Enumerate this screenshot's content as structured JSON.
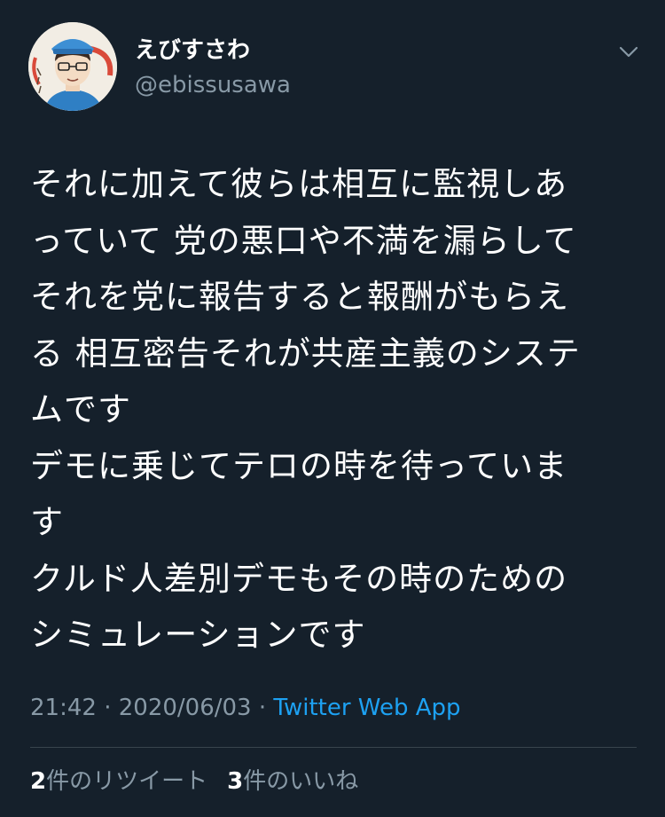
{
  "author": {
    "display_name": "えびすさわ",
    "handle": "@ebissusawa"
  },
  "tweet": {
    "lines": [
      "それに加えて彼らは相互に監視しあ",
      "っていて 党の悪口や不満を漏らして",
      "それを党に報告すると報酬がもらえ",
      "る 相互密告それが共産主義のシステ",
      "ムです",
      "デモに乗じてテロの時を待っていま",
      "す",
      "クルド人差別デモもその時のための",
      "シミュレーションです"
    ],
    "time": "21:42",
    "date": "2020/06/03",
    "separator": "·",
    "source": "Twitter Web App"
  },
  "stats": {
    "retweet_count": "2",
    "retweet_label": "件のリツイート",
    "like_count": "3",
    "like_label": "件のいいね"
  },
  "icons": {
    "menu": "chevron-down-icon"
  },
  "colors": {
    "background": "#15202b",
    "text": "#ffffff",
    "secondary": "#8899a6",
    "link": "#1da1f2",
    "divider": "#38444d"
  }
}
